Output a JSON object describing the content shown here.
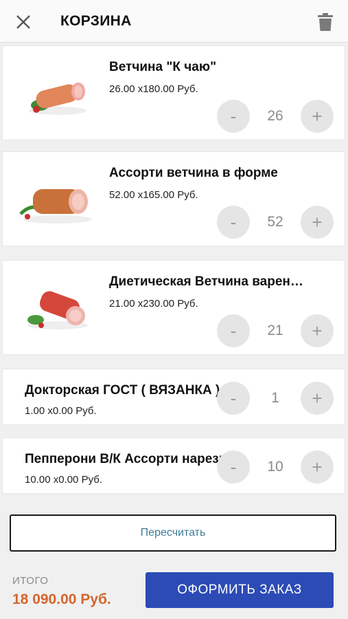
{
  "header": {
    "title": "КОРЗИНА",
    "close_icon": "close-icon",
    "trash_icon": "trash-icon"
  },
  "items": [
    {
      "name": "Ветчина \"К чаю\"",
      "price": "26.00 x180.00 Руб.",
      "qty": "26",
      "minus": "-",
      "plus": "+"
    },
    {
      "name": "Ассорти ветчина в форме",
      "price": "52.00 x165.00 Руб.",
      "qty": "52",
      "minus": "-",
      "plus": "+"
    },
    {
      "name": "Диетическая  Ветчина варен…",
      "price": "21.00 x230.00 Руб.",
      "qty": "21",
      "minus": "-",
      "plus": "+"
    },
    {
      "name": "Докторская ГОСТ ( ВЯЗАНКА )",
      "price": "1.00 x0.00 Руб.",
      "qty": "1",
      "minus": "-",
      "plus": "+"
    },
    {
      "name": "Пепперони  В/К  Ассорти нарезка",
      "price": "10.00 x0.00 Руб.",
      "qty": "10",
      "minus": "-",
      "plus": "+"
    }
  ],
  "recalc_label": "Пересчитать",
  "footer": {
    "total_label": "ИТОГО",
    "total_value": "18 090.00 Руб.",
    "order_label": "ОФОРМИТЬ ЗАКАЗ"
  },
  "colors": {
    "accent": "#2c4bb5",
    "total": "#d5652d",
    "link": "#3d7a96"
  }
}
